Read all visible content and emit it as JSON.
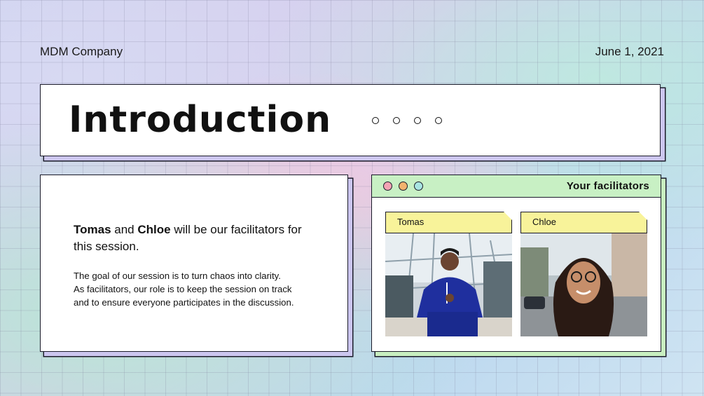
{
  "header": {
    "company": "MDM Company",
    "date": "June 1, 2021"
  },
  "title_card": {
    "title": "Introduction"
  },
  "intro_card": {
    "name1": "Tomas",
    "and_text": " and ",
    "name2": "Chloe",
    "lead_rest": " will be our facilitators for this session.",
    "body_line1": "The goal of our session is to turn chaos into clarity.",
    "body_line2": "As facilitators, our role is to keep the session on track",
    "body_line3": "and to ensure everyone participates in the discussion."
  },
  "facilitators_card": {
    "title": "Your facilitators",
    "window_dot_colors": [
      "#f4a3b4",
      "#f2b26e",
      "#a9e5e2"
    ],
    "people": [
      {
        "name": "Tomas"
      },
      {
        "name": "Chloe"
      }
    ]
  },
  "colors": {
    "title_card_shadow": "#ccc6ef",
    "fac_header": "#c8f0c4",
    "tag_yellow": "#f8f39a"
  }
}
